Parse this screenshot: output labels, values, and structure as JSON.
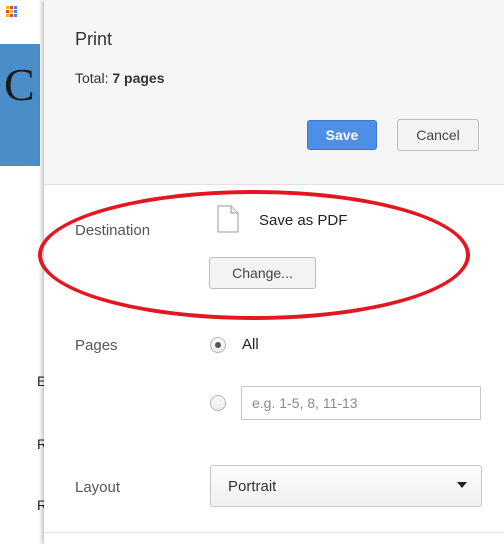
{
  "background": {
    "heading_letter": "C",
    "margin_letters": [
      "E",
      "R",
      "R"
    ]
  },
  "dialog": {
    "title": "Print",
    "total_label": "Total:",
    "total_value": "7 pages",
    "save_label": "Save",
    "cancel_label": "Cancel",
    "destination": {
      "label": "Destination",
      "name": "Save as PDF",
      "change_label": "Change..."
    },
    "pages": {
      "label": "Pages",
      "all_label": "All",
      "all_selected": true,
      "custom_placeholder": "e.g. 1-5, 8, 11-13",
      "custom_value": ""
    },
    "layout": {
      "label": "Layout",
      "value": "Portrait"
    }
  },
  "colors": {
    "save_button": "#4d8ee7",
    "annotation": "#e4161f",
    "banner": "#4a8ec9"
  }
}
